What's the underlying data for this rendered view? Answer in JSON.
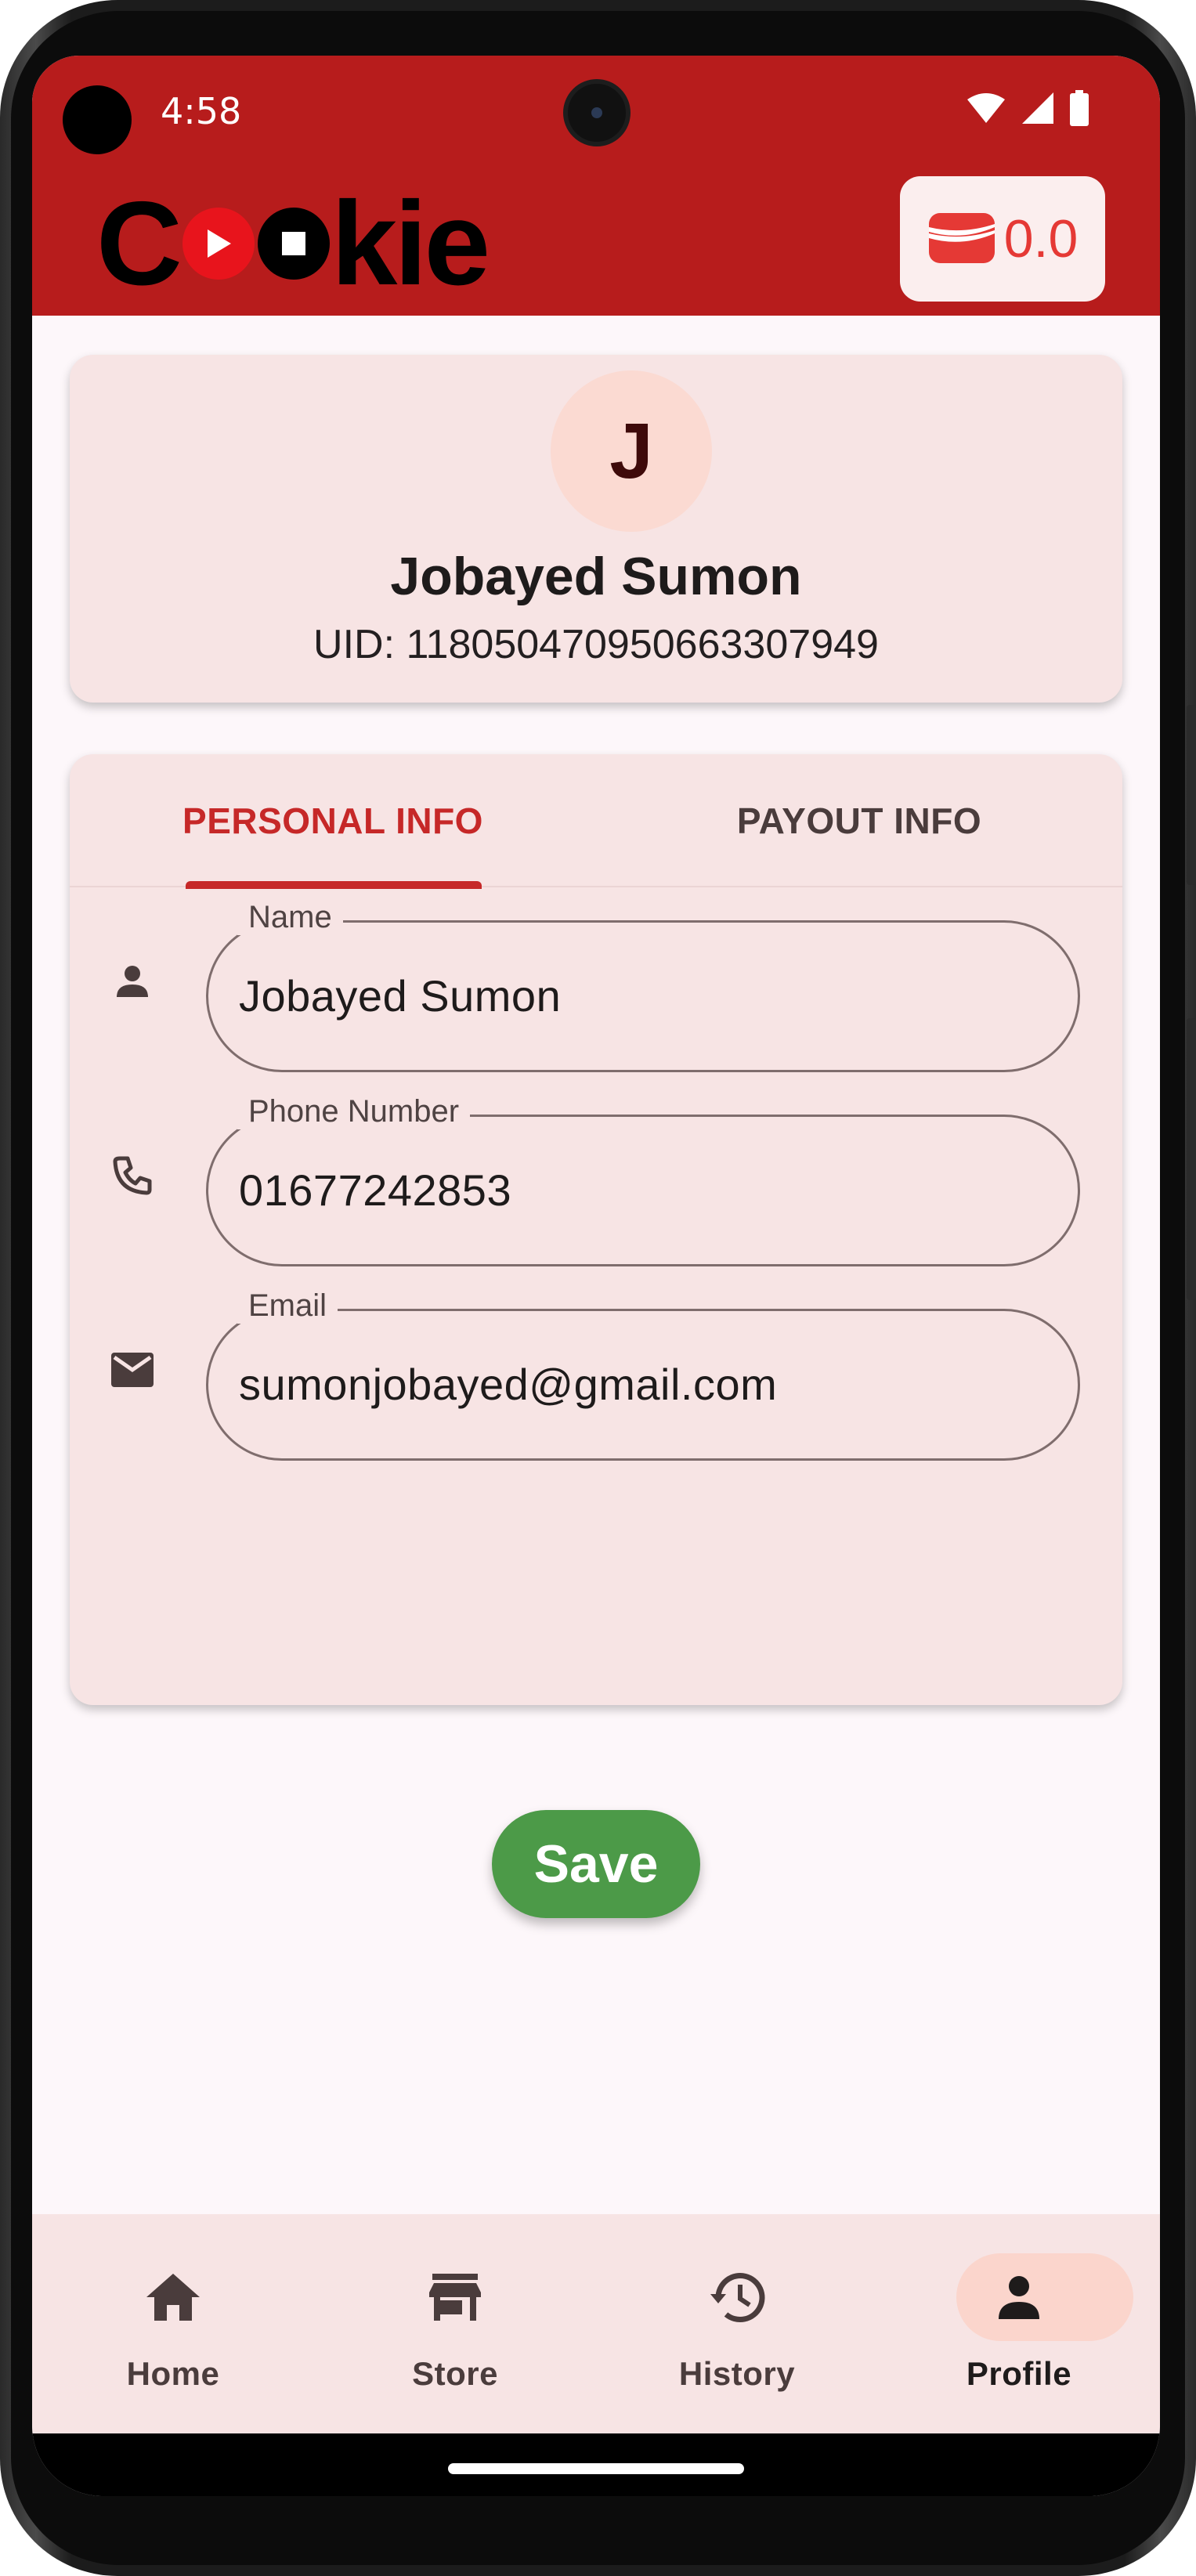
{
  "status_bar": {
    "time": "4:58",
    "icons": [
      "wifi-icon",
      "signal-icon",
      "battery-icon"
    ]
  },
  "app_bar": {
    "logo_text": "Cookie",
    "wallet_icon": "wallet-icon",
    "wallet_balance": "0.0",
    "background_color": "#b71c1c"
  },
  "profile": {
    "avatar_initial": "J",
    "name": "Jobayed Sumon",
    "uid": "UID: 118050470950663307949"
  },
  "tabs": [
    {
      "label": "PERSONAL INFO",
      "selected": true
    },
    {
      "label": "PAYOUT INFO",
      "selected": false
    }
  ],
  "fields": {
    "name": {
      "label": "Name",
      "value": "Jobayed Sumon",
      "icon": "person-icon"
    },
    "phone": {
      "label": "Phone Number",
      "value": "01677242853",
      "icon": "phone-icon"
    },
    "email": {
      "label": "Email",
      "value": "sumonjobayed@gmail.com",
      "icon": "email-icon"
    }
  },
  "save_button": {
    "label": "Save",
    "color": "#4c9a48"
  },
  "bottom_nav": [
    {
      "label": "Home",
      "icon": "home-icon",
      "active": false
    },
    {
      "label": "Store",
      "icon": "store-icon",
      "active": false
    },
    {
      "label": "History",
      "icon": "history-icon",
      "active": false
    },
    {
      "label": "Profile",
      "icon": "person-icon",
      "active": true
    }
  ],
  "colors": {
    "accent": "#c62828",
    "card": "#f7e4e4",
    "screen_background": "#fdf7fa"
  }
}
